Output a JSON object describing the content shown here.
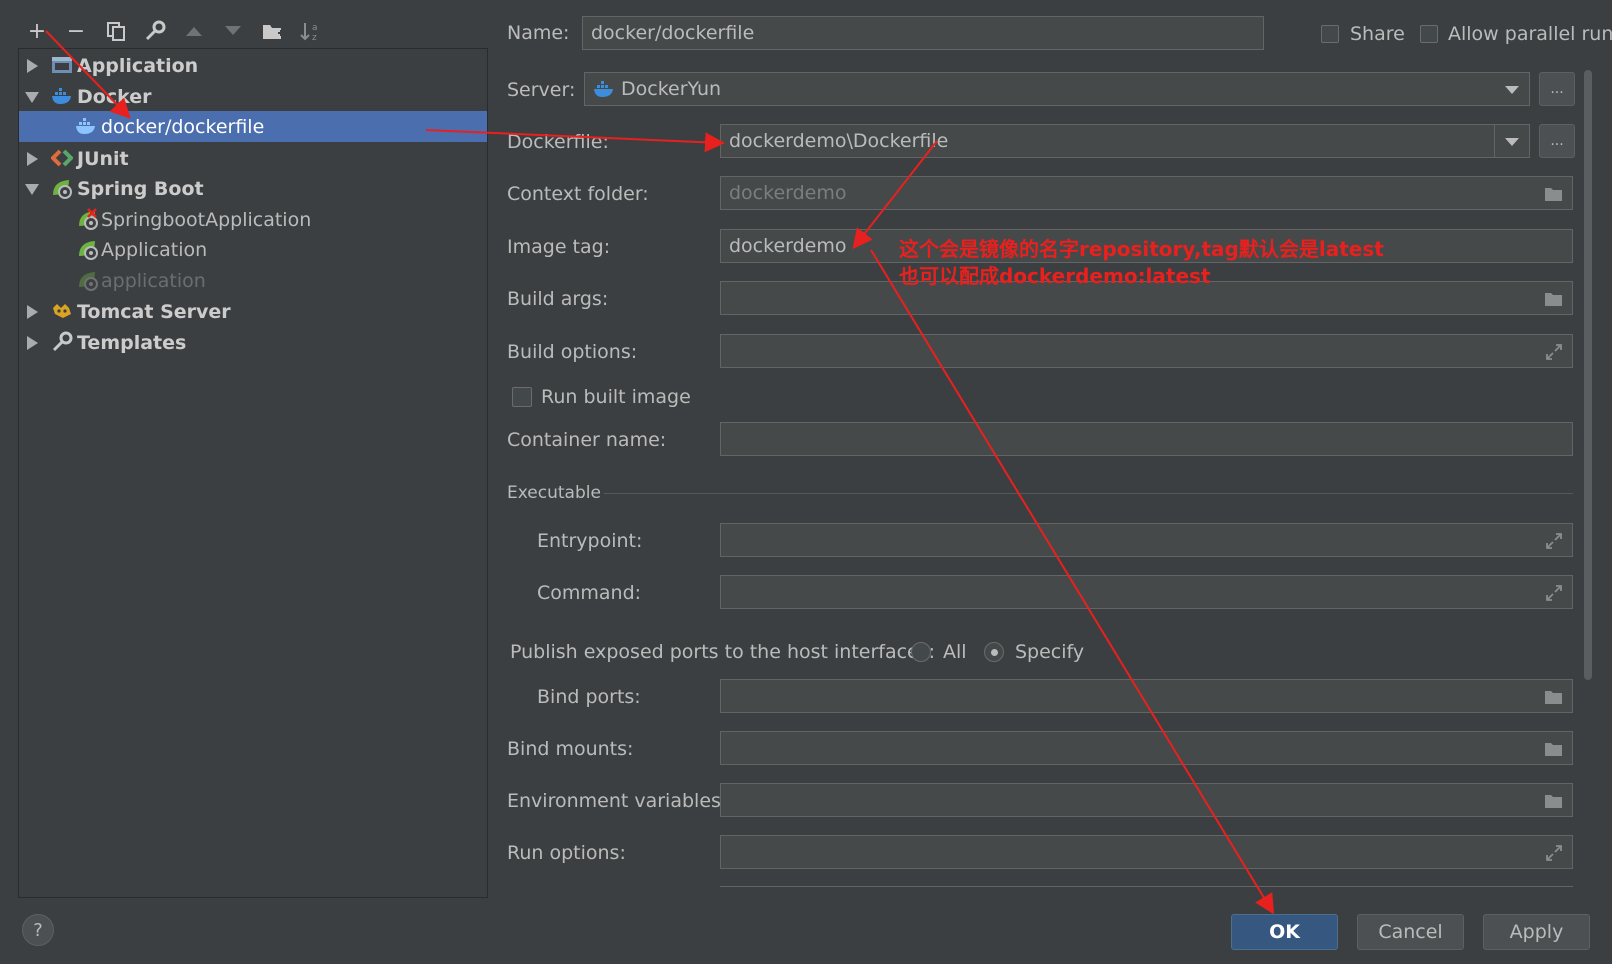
{
  "toolbar": {
    "add": "+",
    "remove": "−",
    "copy": "copy-icon",
    "edit": "wrench-icon",
    "move_up": "arrow-up-icon",
    "move_down": "arrow-down-icon",
    "folder": "new-folder-icon",
    "sort": "sort-icon"
  },
  "tree": {
    "items": [
      {
        "label": "Application",
        "level": 0,
        "expanded": false,
        "icon": "application-icon",
        "bold": true
      },
      {
        "label": "Docker",
        "level": 0,
        "expanded": true,
        "icon": "docker-icon",
        "bold": true
      },
      {
        "label": "docker/dockerfile",
        "level": 1,
        "selected": true,
        "icon": "docker-icon"
      },
      {
        "label": "JUnit",
        "level": 0,
        "expanded": false,
        "icon": "junit-icon",
        "bold": true
      },
      {
        "label": "Spring Boot",
        "level": 0,
        "expanded": true,
        "icon": "spring-boot-icon",
        "bold": true
      },
      {
        "label": "SpringbootApplication",
        "level": 1,
        "icon": "spring-boot-error-icon"
      },
      {
        "label": "Application",
        "level": 1,
        "icon": "spring-boot-icon"
      },
      {
        "label": "application",
        "level": 1,
        "icon": "spring-boot-icon",
        "muted": true
      },
      {
        "label": "Tomcat Server",
        "level": 0,
        "expanded": false,
        "icon": "tomcat-icon",
        "bold": true
      },
      {
        "label": "Templates",
        "level": 0,
        "expanded": false,
        "icon": "wrench-icon",
        "bold": true
      }
    ]
  },
  "form": {
    "name_label": "Name:",
    "name_value": "docker/dockerfile",
    "share_label": "Share",
    "allow_parallel_label": "Allow parallel run",
    "server_label": "Server:",
    "server_value": "DockerYun",
    "dockerfile_label": "Dockerfile:",
    "dockerfile_value": "dockerdemo\\Dockerfile",
    "context_label": "Context folder:",
    "context_value": "dockerdemo",
    "image_tag_label": "Image tag:",
    "image_tag_value": "dockerdemo",
    "build_args_label": "Build args:",
    "build_options_label": "Build options:",
    "run_built_image_label": "Run built image",
    "container_name_label": "Container name:",
    "executable_section": "Executable",
    "entrypoint_label": "Entrypoint:",
    "command_label": "Command:",
    "publish_label": "Publish exposed ports to the host interfaces:",
    "radio_all": "All",
    "radio_specify": "Specify",
    "bind_ports_label": "Bind ports:",
    "bind_mounts_label": "Bind mounts:",
    "env_vars_label": "Environment variables:",
    "run_options_label": "Run options:",
    "dots": "...",
    "browse_icon": "folder-icon",
    "expand_icon": "expand-icon"
  },
  "annotation": {
    "line1": "这个会是镜像的名字repository,tag默认会是latest",
    "line2": "也可以配成dockerdemo:latest",
    "color": "#e8201e"
  },
  "buttons": {
    "help": "?",
    "ok": "OK",
    "cancel": "Cancel",
    "apply": "Apply"
  },
  "colors": {
    "background": "#3c3f41",
    "selection": "#4b6eaf",
    "field": "#45494a",
    "primary_button": "#365880"
  }
}
